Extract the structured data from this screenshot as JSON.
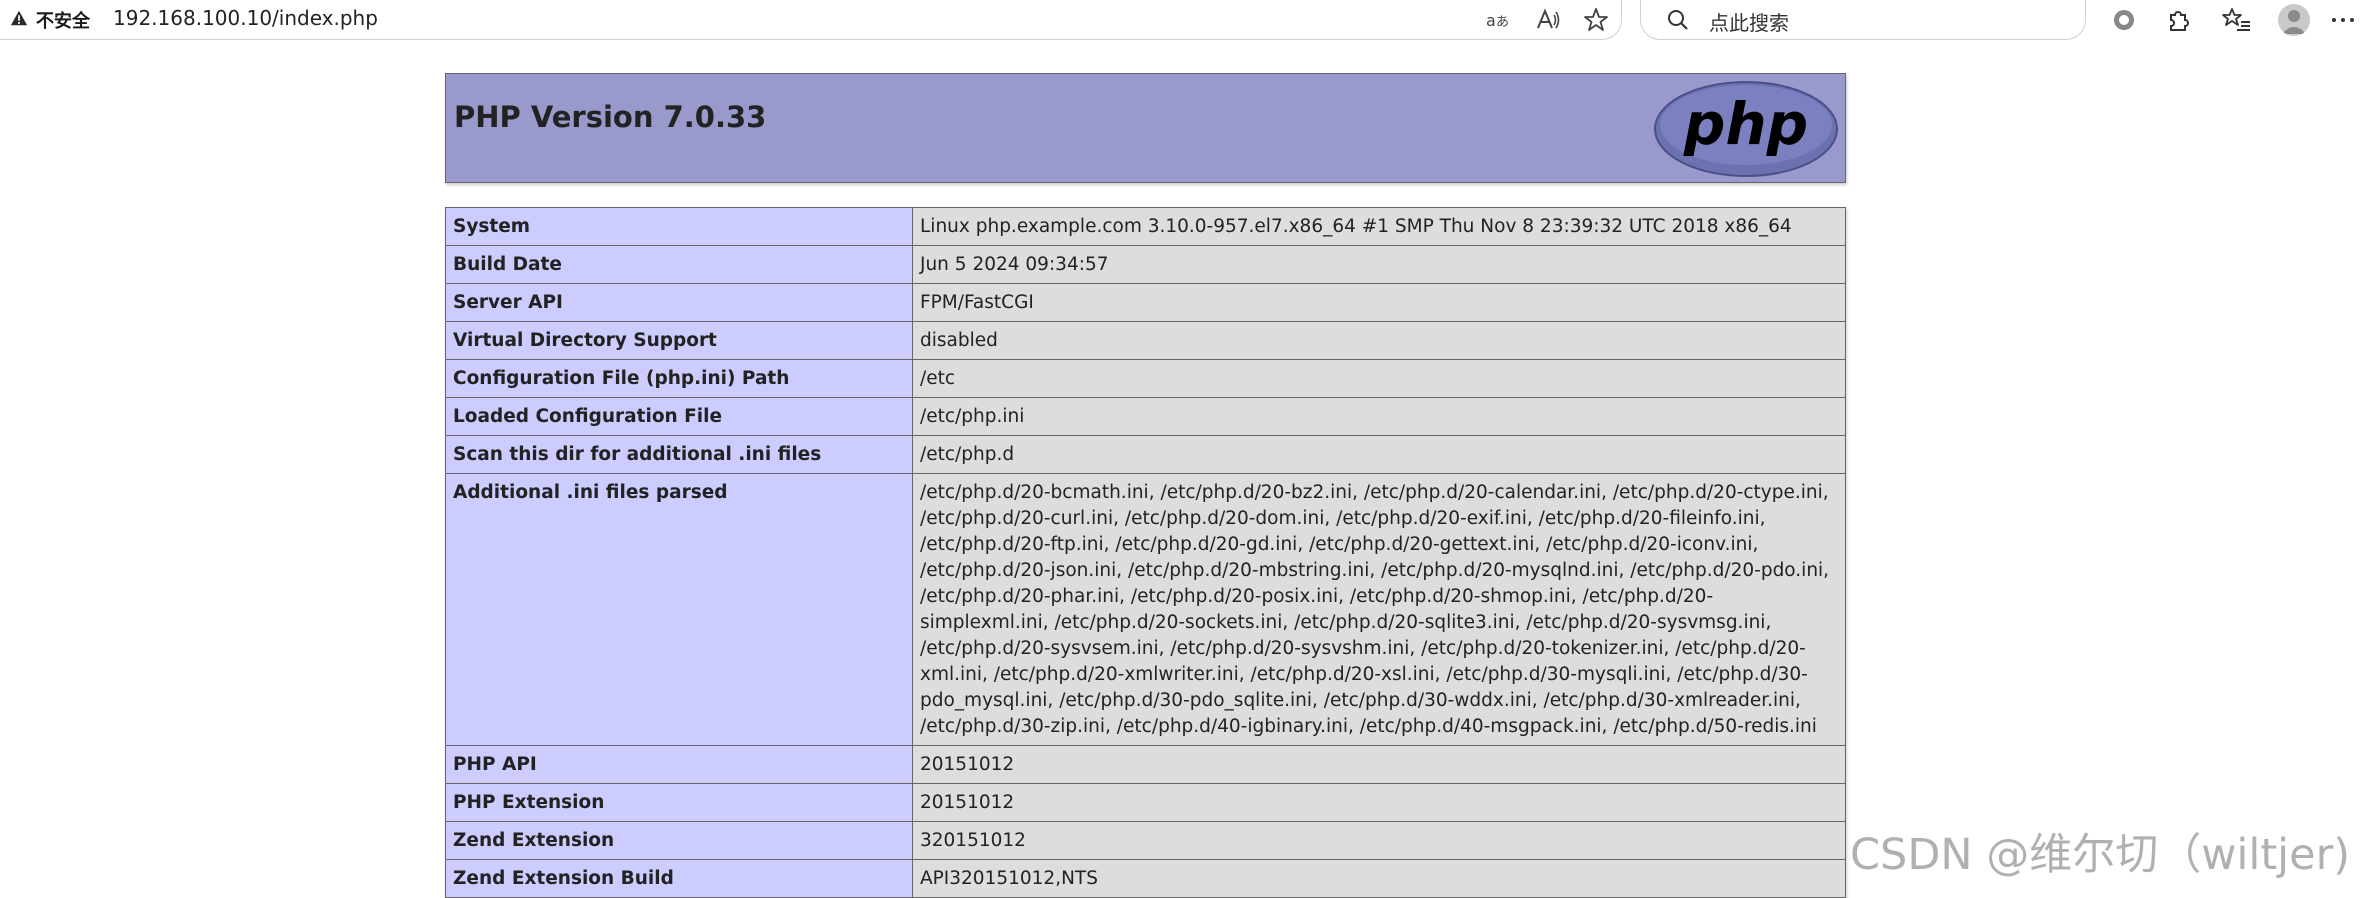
{
  "browser": {
    "security_label": "不安全",
    "url": "192.168.100.10/index.php",
    "search_placeholder": "点此搜索"
  },
  "page": {
    "title": "PHP Version 7.0.33",
    "logo_text": "php",
    "rows": [
      {
        "key": "System",
        "value": "Linux php.example.com 3.10.0-957.el7.x86_64 #1 SMP Thu Nov 8 23:39:32 UTC 2018 x86_64"
      },
      {
        "key": "Build Date",
        "value": "Jun 5 2024 09:34:57"
      },
      {
        "key": "Server API",
        "value": "FPM/FastCGI"
      },
      {
        "key": "Virtual Directory Support",
        "value": "disabled"
      },
      {
        "key": "Configuration File (php.ini) Path",
        "value": "/etc"
      },
      {
        "key": "Loaded Configuration File",
        "value": "/etc/php.ini"
      },
      {
        "key": "Scan this dir for additional .ini files",
        "value": "/etc/php.d"
      },
      {
        "key": "Additional .ini files parsed",
        "value": "/etc/php.d/20-bcmath.ini, /etc/php.d/20-bz2.ini, /etc/php.d/20-calendar.ini, /etc/php.d/20-ctype.ini, /etc/php.d/20-curl.ini, /etc/php.d/20-dom.ini, /etc/php.d/20-exif.ini, /etc/php.d/20-fileinfo.ini, /etc/php.d/20-ftp.ini, /etc/php.d/20-gd.ini, /etc/php.d/20-gettext.ini, /etc/php.d/20-iconv.ini, /etc/php.d/20-json.ini, /etc/php.d/20-mbstring.ini, /etc/php.d/20-mysqlnd.ini, /etc/php.d/20-pdo.ini, /etc/php.d/20-phar.ini, /etc/php.d/20-posix.ini, /etc/php.d/20-shmop.ini, /etc/php.d/20-simplexml.ini, /etc/php.d/20-sockets.ini, /etc/php.d/20-sqlite3.ini, /etc/php.d/20-sysvmsg.ini, /etc/php.d/20-sysvsem.ini, /etc/php.d/20-sysvshm.ini, /etc/php.d/20-tokenizer.ini, /etc/php.d/20-xml.ini, /etc/php.d/20-xmlwriter.ini, /etc/php.d/20-xsl.ini, /etc/php.d/30-mysqli.ini, /etc/php.d/30-pdo_mysql.ini, /etc/php.d/30-pdo_sqlite.ini, /etc/php.d/30-wddx.ini, /etc/php.d/30-xmlreader.ini, /etc/php.d/30-zip.ini, /etc/php.d/40-igbinary.ini, /etc/php.d/40-msgpack.ini, /etc/php.d/50-redis.ini"
      },
      {
        "key": "PHP API",
        "value": "20151012"
      },
      {
        "key": "PHP Extension",
        "value": "20151012"
      },
      {
        "key": "Zend Extension",
        "value": "320151012"
      },
      {
        "key": "Zend Extension Build",
        "value": "API320151012,NTS"
      }
    ]
  },
  "watermark": "CSDN @维尔切（wiltjer)",
  "colors": {
    "header_bg": "#9999cc",
    "key_bg": "#ccccff",
    "value_bg": "#dddddd"
  }
}
